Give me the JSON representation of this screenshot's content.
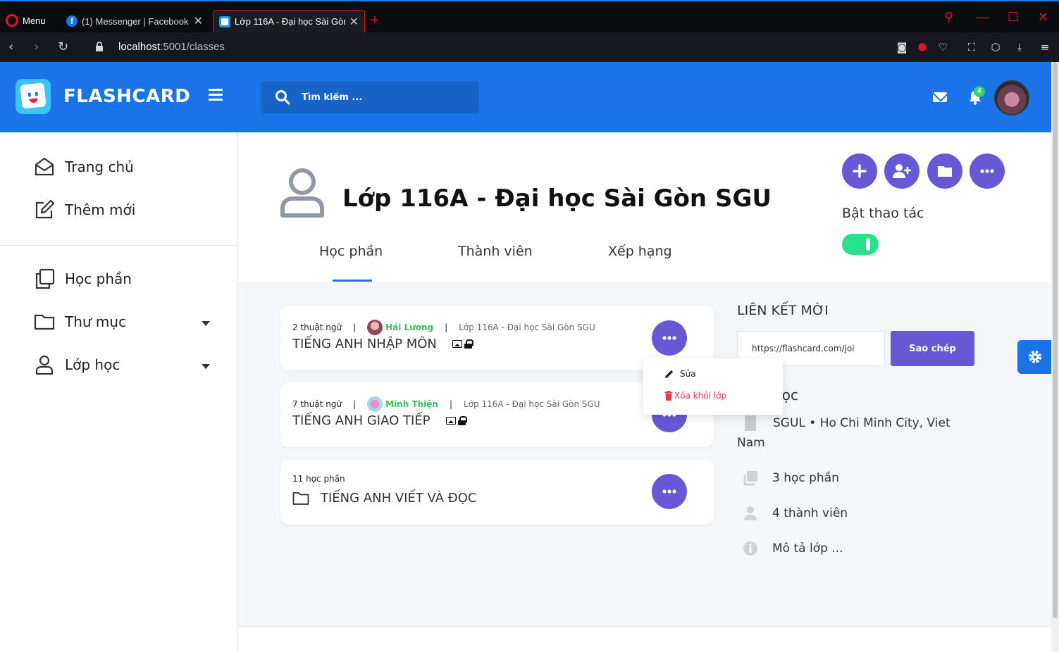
{
  "browser": {
    "menu_label": "Menu",
    "tabs": [
      {
        "label": "(1) Messenger | Facebook"
      },
      {
        "label": "Lớp 116A - Đại học Sài Gòn SGU"
      }
    ],
    "url_host": "localhost",
    "url_rest": ":5001/classes"
  },
  "header": {
    "brand": "FLASHCARD",
    "search_placeholder": "Tìm kiếm ...",
    "notification_count": "4",
    "accent_color": "#1a74e8"
  },
  "sidebar": {
    "items": [
      {
        "label": "Trang chủ",
        "icon": "home-icon"
      },
      {
        "label": "Thêm mới",
        "icon": "edit-icon"
      },
      {
        "label": "Học phần",
        "icon": "copy-icon"
      },
      {
        "label": "Thư mục",
        "icon": "folder-icon"
      },
      {
        "label": "Lớp học",
        "icon": "user-icon"
      }
    ]
  },
  "class": {
    "title": "Lớp 116A - Đại học Sài Gòn SGU",
    "tabs": [
      "Học phần",
      "Thành viên",
      "Xếp hạng"
    ],
    "active_tab": "Học phần",
    "toggle_label": "Bật thao tác",
    "toggle_on": true,
    "action_buttons": [
      "plus-icon",
      "add-user-icon",
      "folder-icon",
      "more-icon"
    ]
  },
  "cards": [
    {
      "count": "2 thuật ngữ",
      "author": "Hải Lương",
      "class": "Lớp 116A - Đại học Sài Gòn SGU",
      "title": "TIẾNG ANH NHẬP MÔN"
    },
    {
      "count": "7 thuật ngữ",
      "author": "Minh Thiện",
      "class": "Lớp 116A - Đại học Sài Gòn SGU",
      "title": "TIẾNG ANH GIAO TIẾP"
    },
    {
      "count": "11 học phần",
      "title": "TIẾNG ANH VIẾT VÀ ĐỌC"
    }
  ],
  "dropdown": {
    "edit_label": "Sửa",
    "delete_label": "Xóa khỏi lớp"
  },
  "invite": {
    "title": "LIÊN KẾT MỜI",
    "link": "https://flashcard.com/joi",
    "copy_label": "Sao chép"
  },
  "info": {
    "heading_visible": "t lớp học",
    "school_line1": "SGUL • Ho Chi Minh City, Viet",
    "school_line2": "Nam",
    "modules": "3 học phần",
    "members": "4 thành viên",
    "description": "Mô tả lớp ..."
  }
}
